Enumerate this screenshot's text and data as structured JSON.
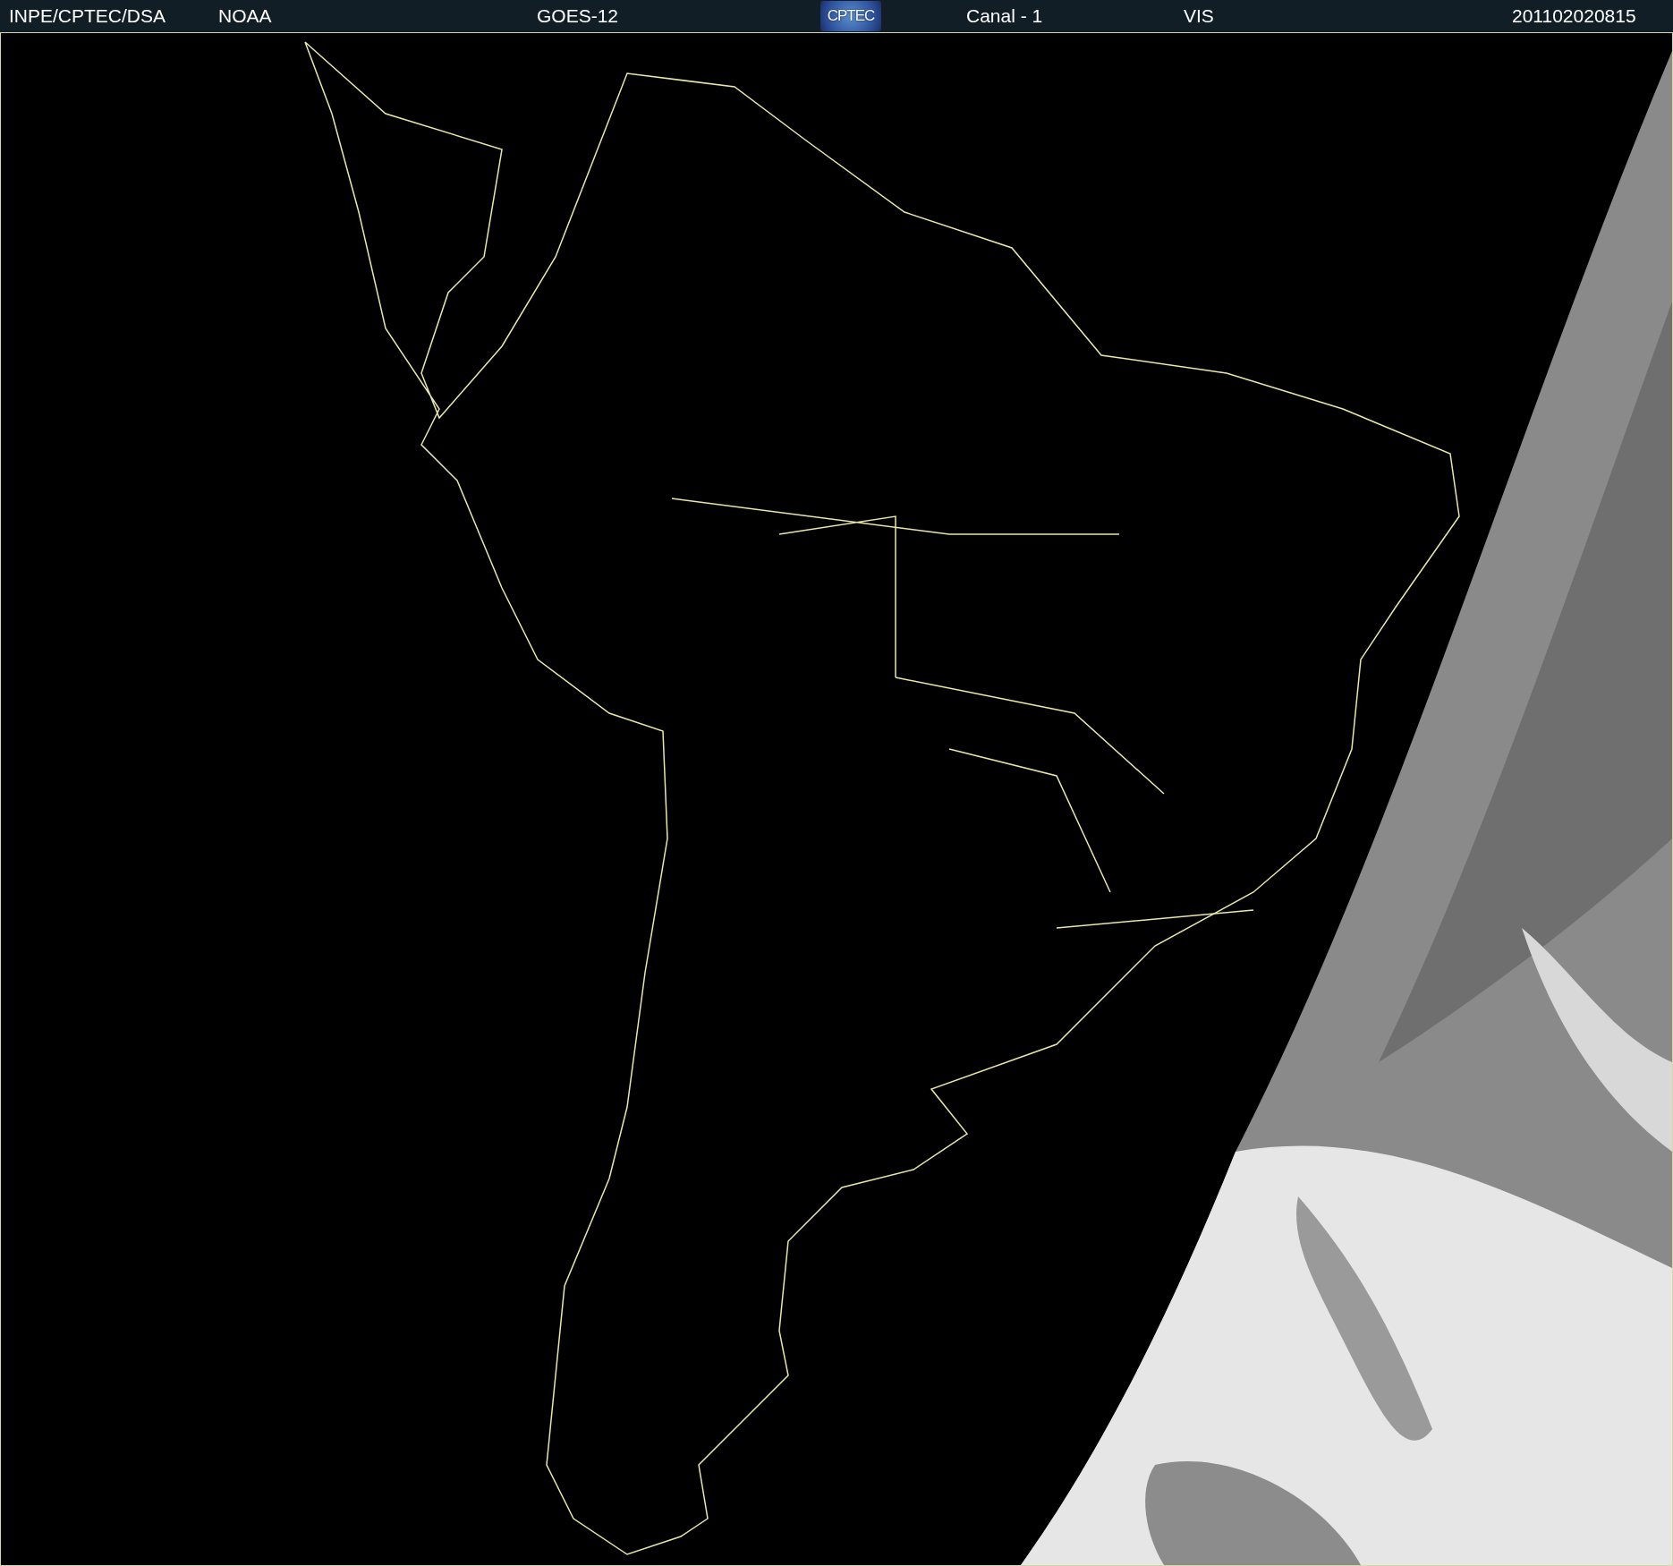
{
  "header": {
    "items": [
      {
        "kind": "text",
        "text": "INPE/CPTEC/DSA"
      },
      {
        "kind": "text",
        "text": "NOAA"
      },
      {
        "kind": "text",
        "text": "GOES-12"
      },
      {
        "kind": "logo",
        "text": "CPTEC"
      },
      {
        "kind": "text",
        "text": "Canal - 1"
      },
      {
        "kind": "text",
        "text": "VIS"
      },
      {
        "kind": "text",
        "text": "201102020815"
      }
    ]
  }
}
